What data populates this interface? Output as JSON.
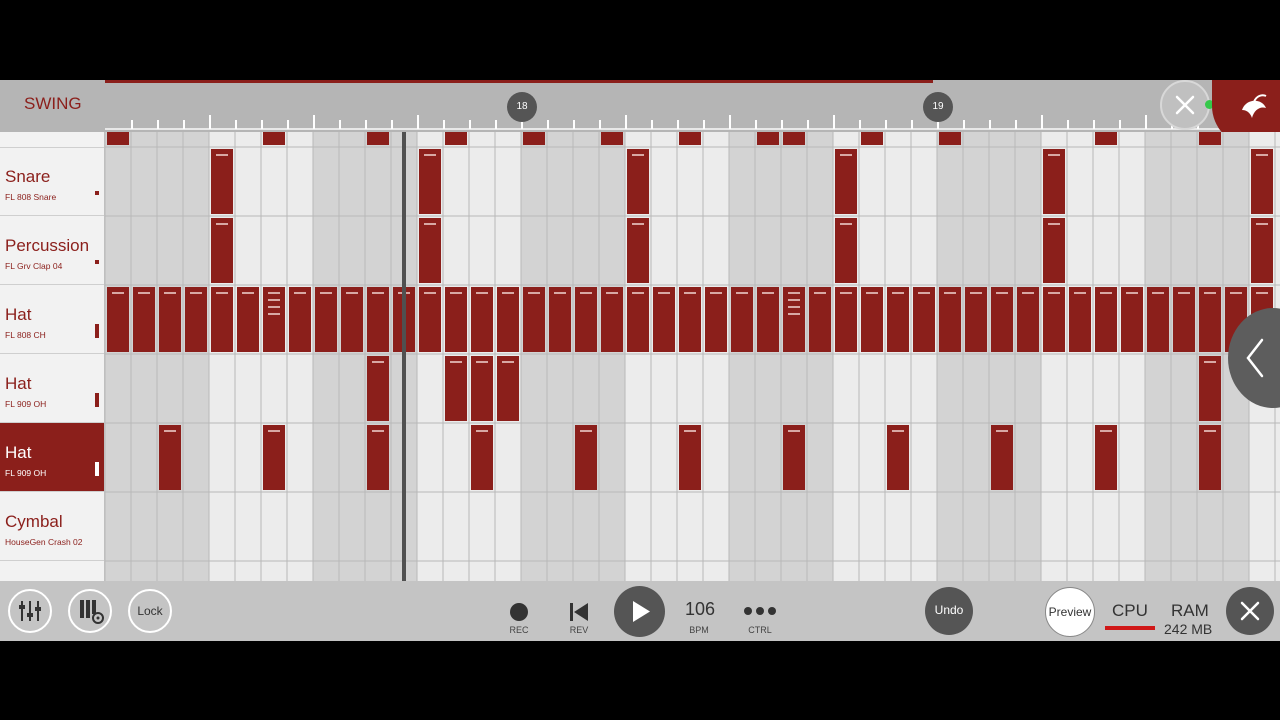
{
  "header": {
    "swing_label": "SWING",
    "bar_markers": [
      {
        "label": "18"
      },
      {
        "label": "19"
      }
    ]
  },
  "tracks": [
    {
      "name": "Snare",
      "sample": "FL 808 Snare",
      "volume": 0.1,
      "selected": false
    },
    {
      "name": "Percussion",
      "sample": "FL Grv Clap 04",
      "volume": 0.1,
      "selected": false
    },
    {
      "name": "Hat",
      "sample": "FL 808 CH",
      "volume": 0.4,
      "selected": false
    },
    {
      "name": "Hat",
      "sample": "FL 909 OH",
      "volume": 0.4,
      "selected": false
    },
    {
      "name": "Hat",
      "sample": "FL 909 OH",
      "volume": 0.4,
      "selected": true
    },
    {
      "name": "Cymbal",
      "sample": "HouseGen Crash 02",
      "volume": 0,
      "selected": false
    }
  ],
  "pattern": {
    "steps_visible": 45,
    "top_partial_row": [
      0,
      6,
      10,
      13,
      16,
      19,
      22,
      25,
      26,
      29,
      32,
      38,
      42
    ],
    "rows": [
      [
        4,
        12,
        20,
        28,
        36,
        44
      ],
      [
        4,
        12,
        20,
        28,
        36,
        44
      ],
      [
        0,
        1,
        2,
        3,
        4,
        5,
        6,
        7,
        8,
        9,
        10,
        11,
        12,
        13,
        14,
        15,
        16,
        17,
        18,
        19,
        20,
        21,
        22,
        23,
        24,
        25,
        26,
        27,
        28,
        29,
        30,
        31,
        32,
        33,
        34,
        35,
        36,
        37,
        38,
        39,
        40,
        41,
        42,
        43,
        44
      ],
      [
        10,
        13,
        14,
        15,
        42
      ],
      [
        2,
        6,
        10,
        14,
        18,
        22,
        26,
        30,
        34,
        38,
        42
      ],
      []
    ],
    "multi_notes": [
      [
        2,
        6
      ],
      [
        2,
        26
      ]
    ]
  },
  "transport": {
    "lock_label": "Lock",
    "rec_label": "REC",
    "rev_label": "REV",
    "bpm_value": "106",
    "bpm_label": "BPM",
    "ctrl_label": "CTRL",
    "undo_label": "Undo",
    "preview_label": "Preview",
    "cpu_label": "CPU",
    "cpu_load": 1.0,
    "ram_label": "RAM",
    "ram_value": "242 MB"
  },
  "colors": {
    "accent": "#8b1f1b",
    "cpu_meter": "#d01818",
    "status_dot": "#35c84a"
  },
  "icons": {
    "mixer": "mixer-icon",
    "piano_settings": "piano-settings-icon",
    "rec": "record-icon",
    "rev": "rewind-icon",
    "play": "play-icon",
    "ctrl": "dots-icon",
    "close": "close-icon",
    "logo": "fruit-logo-icon"
  }
}
